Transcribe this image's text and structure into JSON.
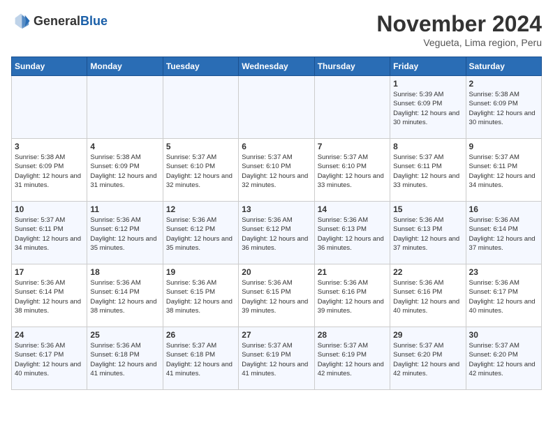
{
  "logo": {
    "general": "General",
    "blue": "Blue"
  },
  "title": "November 2024",
  "subtitle": "Vegueta, Lima region, Peru",
  "weekdays": [
    "Sunday",
    "Monday",
    "Tuesday",
    "Wednesday",
    "Thursday",
    "Friday",
    "Saturday"
  ],
  "weeks": [
    [
      {
        "day": "",
        "info": ""
      },
      {
        "day": "",
        "info": ""
      },
      {
        "day": "",
        "info": ""
      },
      {
        "day": "",
        "info": ""
      },
      {
        "day": "",
        "info": ""
      },
      {
        "day": "1",
        "info": "Sunrise: 5:39 AM\nSunset: 6:09 PM\nDaylight: 12 hours and 30 minutes."
      },
      {
        "day": "2",
        "info": "Sunrise: 5:38 AM\nSunset: 6:09 PM\nDaylight: 12 hours and 30 minutes."
      }
    ],
    [
      {
        "day": "3",
        "info": "Sunrise: 5:38 AM\nSunset: 6:09 PM\nDaylight: 12 hours and 31 minutes."
      },
      {
        "day": "4",
        "info": "Sunrise: 5:38 AM\nSunset: 6:09 PM\nDaylight: 12 hours and 31 minutes."
      },
      {
        "day": "5",
        "info": "Sunrise: 5:37 AM\nSunset: 6:10 PM\nDaylight: 12 hours and 32 minutes."
      },
      {
        "day": "6",
        "info": "Sunrise: 5:37 AM\nSunset: 6:10 PM\nDaylight: 12 hours and 32 minutes."
      },
      {
        "day": "7",
        "info": "Sunrise: 5:37 AM\nSunset: 6:10 PM\nDaylight: 12 hours and 33 minutes."
      },
      {
        "day": "8",
        "info": "Sunrise: 5:37 AM\nSunset: 6:11 PM\nDaylight: 12 hours and 33 minutes."
      },
      {
        "day": "9",
        "info": "Sunrise: 5:37 AM\nSunset: 6:11 PM\nDaylight: 12 hours and 34 minutes."
      }
    ],
    [
      {
        "day": "10",
        "info": "Sunrise: 5:37 AM\nSunset: 6:11 PM\nDaylight: 12 hours and 34 minutes."
      },
      {
        "day": "11",
        "info": "Sunrise: 5:36 AM\nSunset: 6:12 PM\nDaylight: 12 hours and 35 minutes."
      },
      {
        "day": "12",
        "info": "Sunrise: 5:36 AM\nSunset: 6:12 PM\nDaylight: 12 hours and 35 minutes."
      },
      {
        "day": "13",
        "info": "Sunrise: 5:36 AM\nSunset: 6:12 PM\nDaylight: 12 hours and 36 minutes."
      },
      {
        "day": "14",
        "info": "Sunrise: 5:36 AM\nSunset: 6:13 PM\nDaylight: 12 hours and 36 minutes."
      },
      {
        "day": "15",
        "info": "Sunrise: 5:36 AM\nSunset: 6:13 PM\nDaylight: 12 hours and 37 minutes."
      },
      {
        "day": "16",
        "info": "Sunrise: 5:36 AM\nSunset: 6:14 PM\nDaylight: 12 hours and 37 minutes."
      }
    ],
    [
      {
        "day": "17",
        "info": "Sunrise: 5:36 AM\nSunset: 6:14 PM\nDaylight: 12 hours and 38 minutes."
      },
      {
        "day": "18",
        "info": "Sunrise: 5:36 AM\nSunset: 6:14 PM\nDaylight: 12 hours and 38 minutes."
      },
      {
        "day": "19",
        "info": "Sunrise: 5:36 AM\nSunset: 6:15 PM\nDaylight: 12 hours and 38 minutes."
      },
      {
        "day": "20",
        "info": "Sunrise: 5:36 AM\nSunset: 6:15 PM\nDaylight: 12 hours and 39 minutes."
      },
      {
        "day": "21",
        "info": "Sunrise: 5:36 AM\nSunset: 6:16 PM\nDaylight: 12 hours and 39 minutes."
      },
      {
        "day": "22",
        "info": "Sunrise: 5:36 AM\nSunset: 6:16 PM\nDaylight: 12 hours and 40 minutes."
      },
      {
        "day": "23",
        "info": "Sunrise: 5:36 AM\nSunset: 6:17 PM\nDaylight: 12 hours and 40 minutes."
      }
    ],
    [
      {
        "day": "24",
        "info": "Sunrise: 5:36 AM\nSunset: 6:17 PM\nDaylight: 12 hours and 40 minutes."
      },
      {
        "day": "25",
        "info": "Sunrise: 5:36 AM\nSunset: 6:18 PM\nDaylight: 12 hours and 41 minutes."
      },
      {
        "day": "26",
        "info": "Sunrise: 5:37 AM\nSunset: 6:18 PM\nDaylight: 12 hours and 41 minutes."
      },
      {
        "day": "27",
        "info": "Sunrise: 5:37 AM\nSunset: 6:19 PM\nDaylight: 12 hours and 41 minutes."
      },
      {
        "day": "28",
        "info": "Sunrise: 5:37 AM\nSunset: 6:19 PM\nDaylight: 12 hours and 42 minutes."
      },
      {
        "day": "29",
        "info": "Sunrise: 5:37 AM\nSunset: 6:20 PM\nDaylight: 12 hours and 42 minutes."
      },
      {
        "day": "30",
        "info": "Sunrise: 5:37 AM\nSunset: 6:20 PM\nDaylight: 12 hours and 42 minutes."
      }
    ]
  ]
}
